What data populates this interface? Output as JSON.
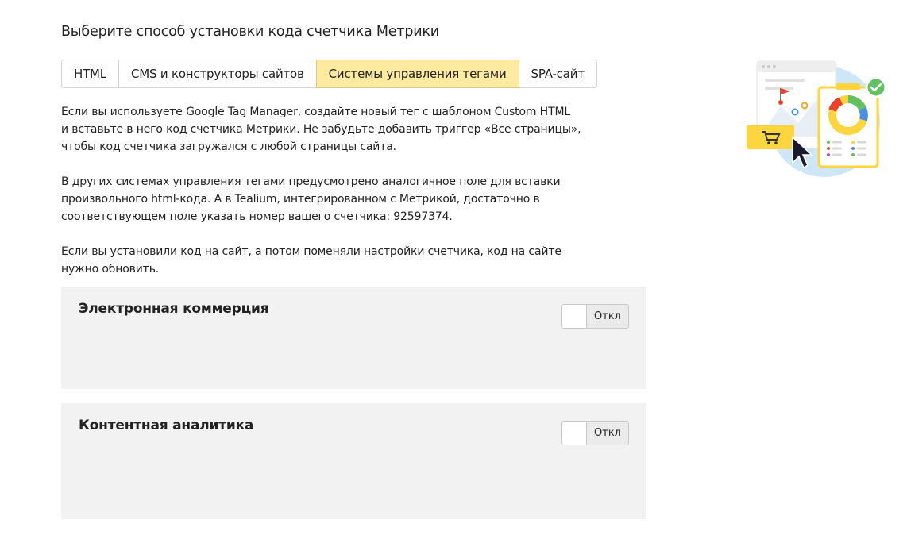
{
  "heading": "Выберите способ установки кода счетчика Метрики",
  "tabs": [
    {
      "label": "HTML",
      "active": false
    },
    {
      "label": "CMS и конструкторы сайтов",
      "active": false
    },
    {
      "label": "Системы управления тегами",
      "active": true
    },
    {
      "label": "SPA-сайт",
      "active": false
    }
  ],
  "description": {
    "p1": "Если вы используете Google Tag Manager, создайте новый тег с шаблоном Custom HTML\nи вставьте в него код счетчика Метрики. Не забудьте добавить триггер «Все страницы»,\nчтобы код счетчика загружался с любой страницы сайта.",
    "p2": "В других системах управления тегами предусмотрено аналогичное поле для вставки\nпроизвольного html-кода. А в Tealium, интегрированном с Метрикой, достаточно в\nсоответствующем поле указать номер вашего счетчика: 92597374.",
    "p3": "Если вы установили код на сайт, а потом поменяли настройки счетчика, код на сайте\nнужно обновить."
  },
  "panels": {
    "ecommerce": {
      "title": "Электронная коммерция",
      "toggle_label": "Откл"
    },
    "content_analytics": {
      "title": "Контентная аналитика",
      "toggle_label": "Откл"
    }
  },
  "colors": {
    "active_tab": "#ffeba0",
    "panel_bg": "#f2f2f2",
    "illustration_circle": "#cde7f7",
    "accent_yellow": "#fcd53f",
    "check_green": "#62c162"
  }
}
